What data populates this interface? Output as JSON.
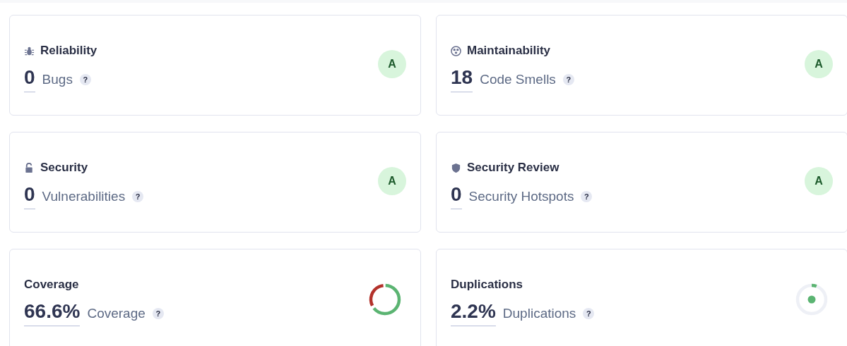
{
  "cards": [
    {
      "kind": "rating",
      "title": "Reliability",
      "value": "0",
      "label": "Bugs",
      "help": "?",
      "grade": "A"
    },
    {
      "kind": "rating",
      "title": "Maintainability",
      "value": "18",
      "label": "Code Smells",
      "help": "?",
      "grade": "A"
    },
    {
      "kind": "rating",
      "title": "Security",
      "value": "0",
      "label": "Vulnerabilities",
      "help": "?",
      "grade": "A"
    },
    {
      "kind": "rating",
      "title": "Security Review",
      "value": "0",
      "label": "Security Hotspots",
      "help": "?",
      "grade": "A"
    },
    {
      "kind": "coverage",
      "title": "Coverage",
      "value": "66.6%",
      "label": "Coverage",
      "help": "?"
    },
    {
      "kind": "duplication",
      "title": "Duplications",
      "value": "2.2%",
      "label": "Duplications",
      "help": "?"
    }
  ]
}
